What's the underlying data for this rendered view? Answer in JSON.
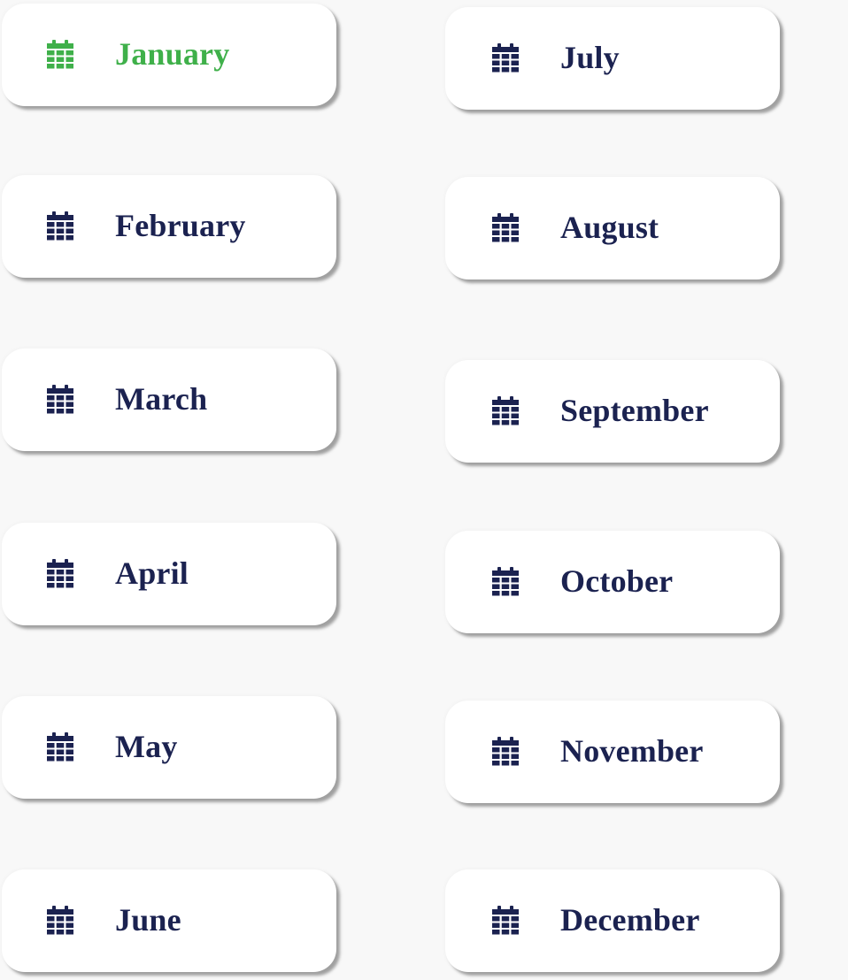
{
  "colors": {
    "background": "#f8f8f8",
    "card": "#ffffff",
    "text": "#1b2250",
    "active": "#3fb04a"
  },
  "months": [
    {
      "label": "January",
      "icon": "calendar-icon",
      "active": true
    },
    {
      "label": "February",
      "icon": "calendar-icon",
      "active": false
    },
    {
      "label": "March",
      "icon": "calendar-icon",
      "active": false
    },
    {
      "label": "April",
      "icon": "calendar-icon",
      "active": false
    },
    {
      "label": "May",
      "icon": "calendar-icon",
      "active": false
    },
    {
      "label": "June",
      "icon": "calendar-icon",
      "active": false
    },
    {
      "label": "July",
      "icon": "calendar-icon",
      "active": false
    },
    {
      "label": "August",
      "icon": "calendar-icon",
      "active": false
    },
    {
      "label": "September",
      "icon": "calendar-icon",
      "active": false
    },
    {
      "label": "October",
      "icon": "calendar-icon",
      "active": false
    },
    {
      "label": "November",
      "icon": "calendar-icon",
      "active": false
    },
    {
      "label": "December",
      "icon": "calendar-icon",
      "active": false
    }
  ]
}
